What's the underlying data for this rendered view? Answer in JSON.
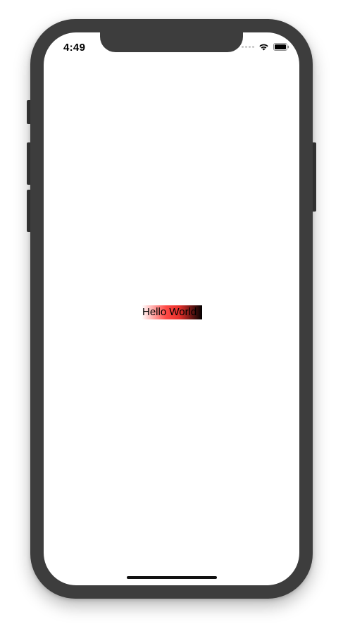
{
  "status_bar": {
    "time": "4:49",
    "icons": [
      "signal-dots-icon",
      "wifi-icon",
      "battery-icon"
    ]
  },
  "main": {
    "label_text": "Hello World",
    "label_gradient": [
      "#ffffff",
      "#ff4a46",
      "#000000"
    ]
  },
  "device": {
    "frame_color": "#3d3d3d"
  }
}
